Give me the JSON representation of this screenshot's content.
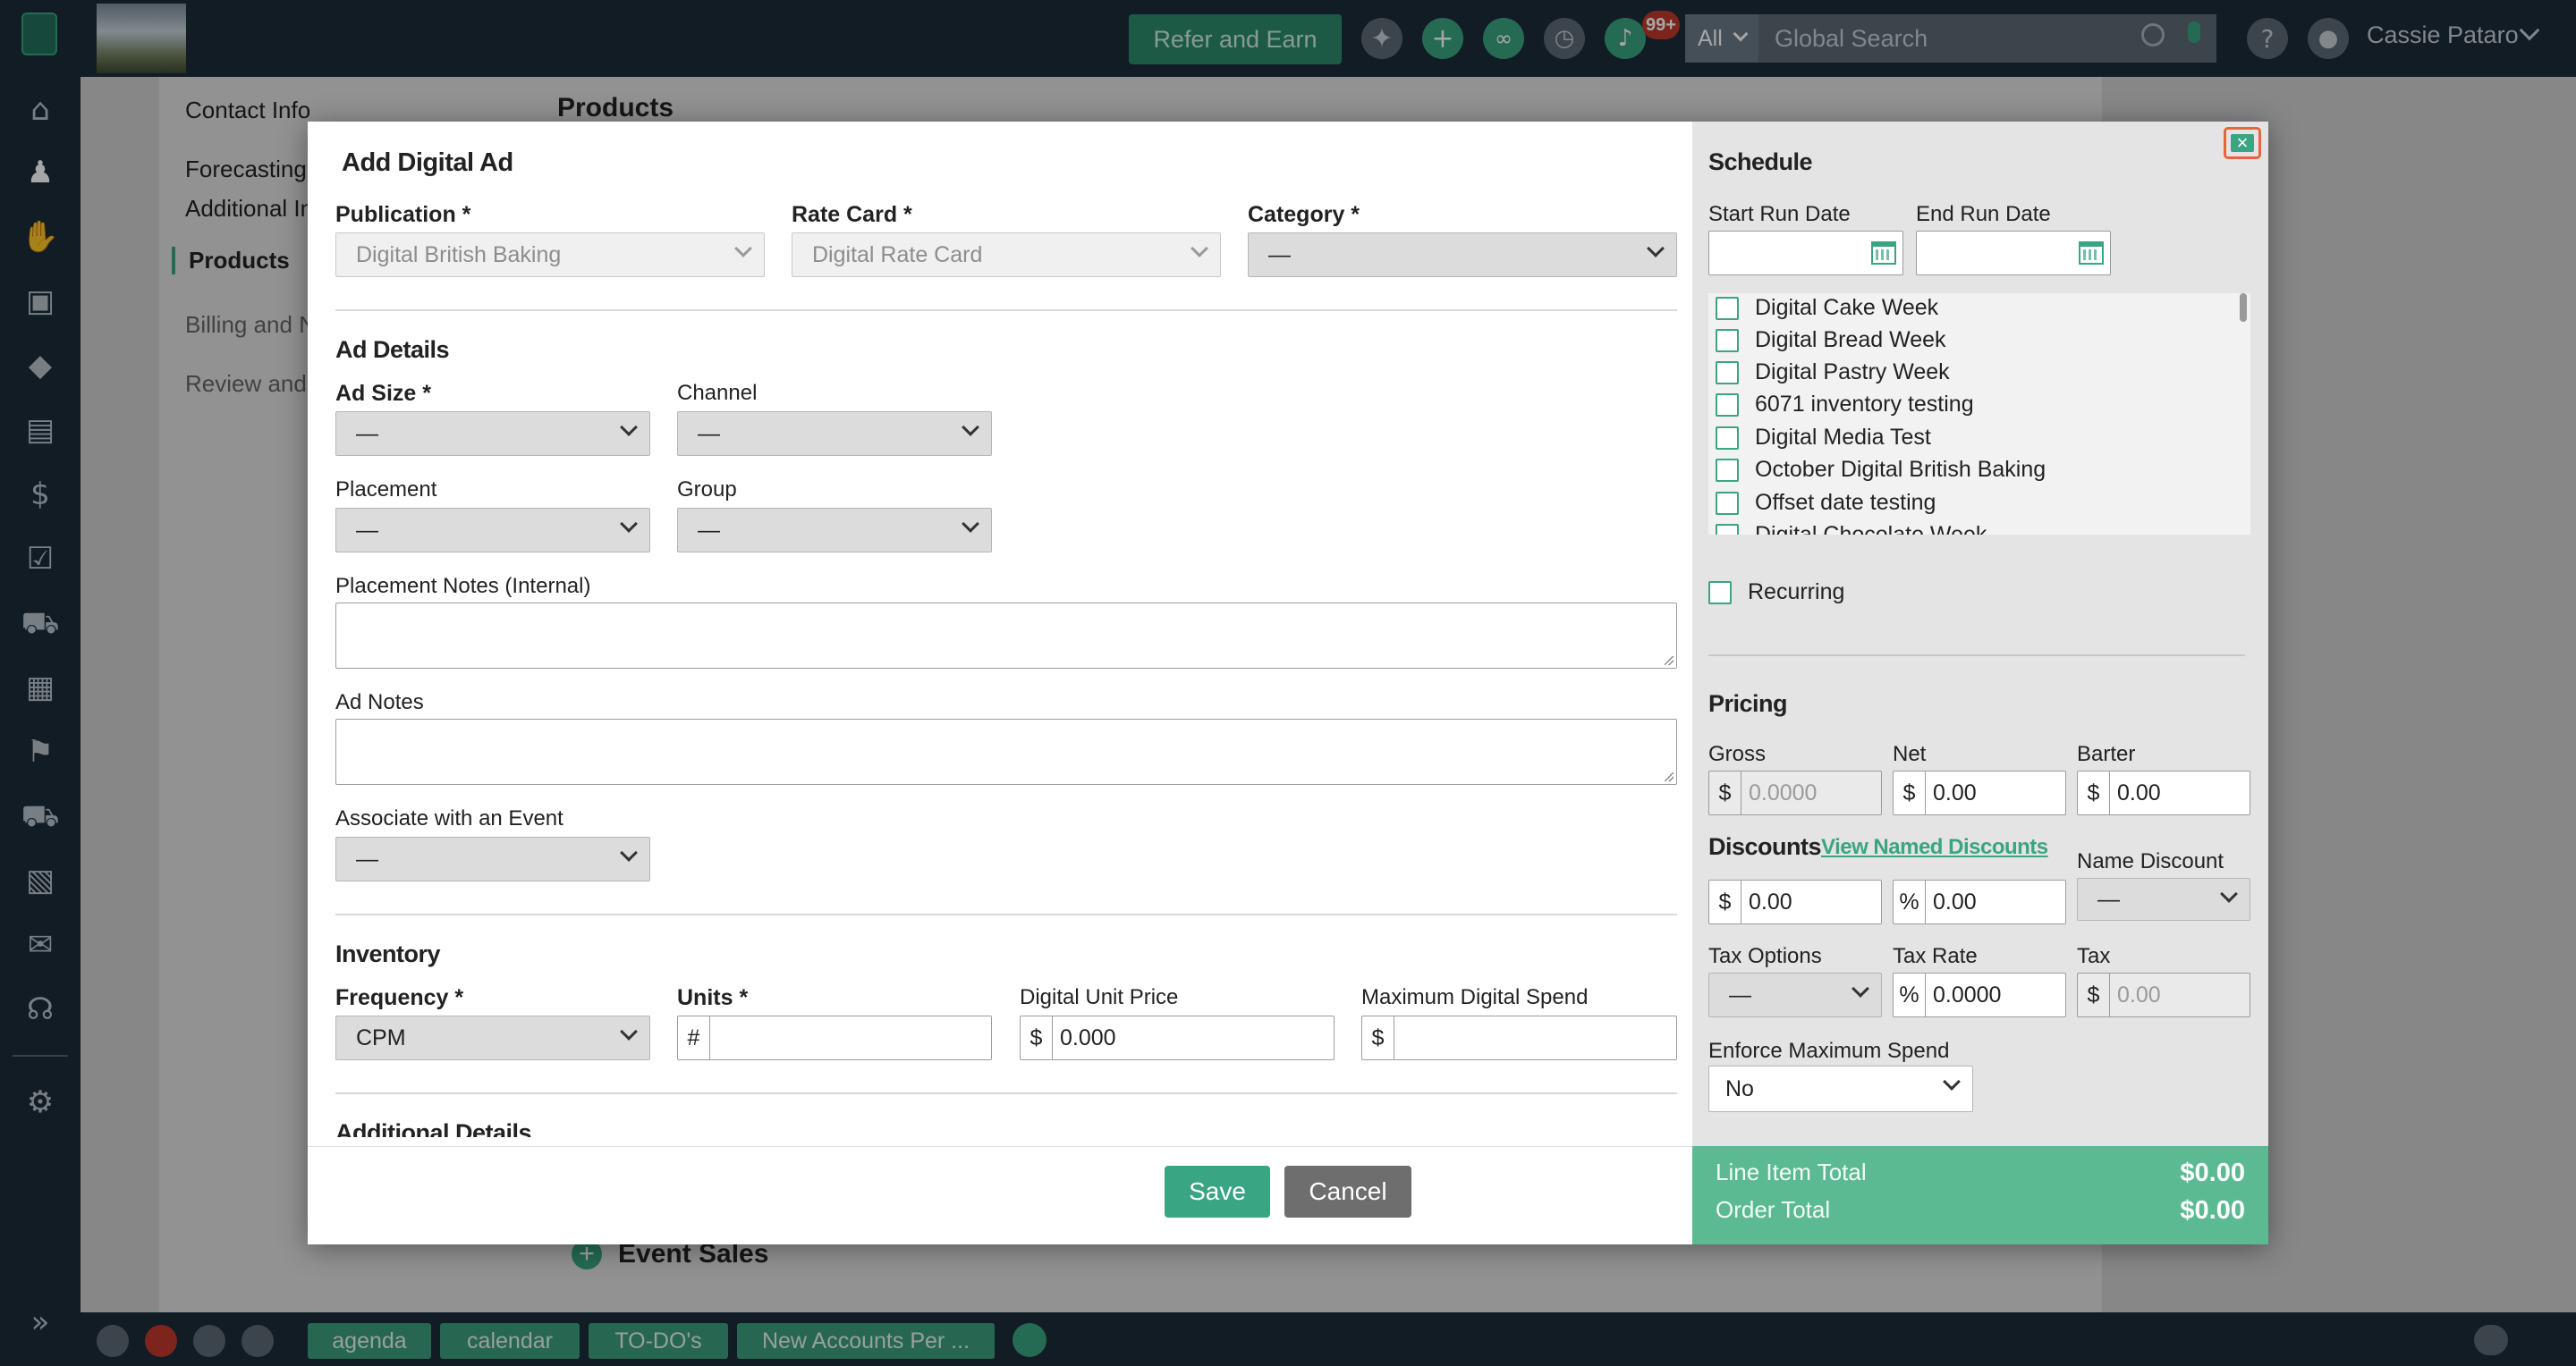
{
  "topbar": {
    "refer_label": "Refer and Earn",
    "notif_badge": "99+",
    "search_scope": "All",
    "search_placeholder": "Global Search",
    "user_name": "Cassie Pataro"
  },
  "background": {
    "nav": [
      "Contact Info",
      "Forecasting",
      "Additional In",
      "Products",
      "Billing and N",
      "Review and"
    ],
    "products_heading": "Products",
    "event_sales": "Event Sales"
  },
  "bottombar": {
    "tabs": [
      "agenda",
      "calendar",
      "TO-DO's",
      "New Accounts Per ..."
    ]
  },
  "modal": {
    "title": "Add Digital Ad",
    "close_glyph": "×",
    "publication": {
      "label": "Publication *",
      "value": "Digital British Baking"
    },
    "rate_card": {
      "label": "Rate Card *",
      "value": "Digital Rate Card"
    },
    "category": {
      "label": "Category *",
      "value": "—"
    },
    "ad_details": {
      "heading": "Ad Details",
      "ad_size": {
        "label": "Ad Size *",
        "value": "—"
      },
      "channel": {
        "label": "Channel",
        "value": "—"
      },
      "placement": {
        "label": "Placement",
        "value": "—"
      },
      "group": {
        "label": "Group",
        "value": "—"
      },
      "placement_notes_label": "Placement Notes (Internal)",
      "ad_notes_label": "Ad Notes",
      "event": {
        "label": "Associate with an Event",
        "value": "—"
      }
    },
    "inventory": {
      "heading": "Inventory",
      "frequency": {
        "label": "Frequency *",
        "value": "CPM"
      },
      "units": {
        "label": "Units *",
        "prefix": "#",
        "value": ""
      },
      "unit_price": {
        "label": "Digital Unit Price",
        "prefix": "$",
        "value": "0.000"
      },
      "max_spend": {
        "label": "Maximum Digital Spend",
        "prefix": "$",
        "value": ""
      }
    },
    "additional_heading": "Additional Details",
    "save_label": "Save",
    "cancel_label": "Cancel",
    "schedule": {
      "heading": "Schedule",
      "start_label": "Start Run Date",
      "end_label": "End Run Date",
      "issues": [
        "Digital Cake Week",
        "Digital Bread Week",
        "Digital Pastry Week",
        "6071 inventory testing",
        "Digital Media Test",
        "October Digital British Baking",
        "Offset date testing",
        "Digital Chocolate Week"
      ],
      "recurring_label": "Recurring"
    },
    "pricing": {
      "heading": "Pricing",
      "gross": {
        "label": "Gross",
        "prefix": "$",
        "value": "0.0000"
      },
      "net": {
        "label": "Net",
        "prefix": "$",
        "value": "0.00"
      },
      "barter": {
        "label": "Barter",
        "prefix": "$",
        "value": "0.00"
      },
      "discounts_heading": "Discounts",
      "named_discounts_link": "View Named Discounts",
      "discount_amount": {
        "prefix": "$",
        "value": "0.00"
      },
      "discount_percent": {
        "prefix": "%",
        "value": "0.00"
      },
      "name_discount": {
        "label": "Name Discount",
        "value": "—"
      },
      "tax_options": {
        "label": "Tax Options",
        "value": "—"
      },
      "tax_rate": {
        "label": "Tax Rate",
        "prefix": "%",
        "value": "0.0000"
      },
      "tax": {
        "label": "Tax",
        "prefix": "$",
        "value": "0.00"
      },
      "enforce": {
        "label": "Enforce Maximum Spend",
        "value": "No"
      }
    },
    "totals": {
      "line_item_label": "Line Item Total",
      "line_item_value": "$0.00",
      "order_label": "Order Total",
      "order_value": "$0.00"
    }
  }
}
